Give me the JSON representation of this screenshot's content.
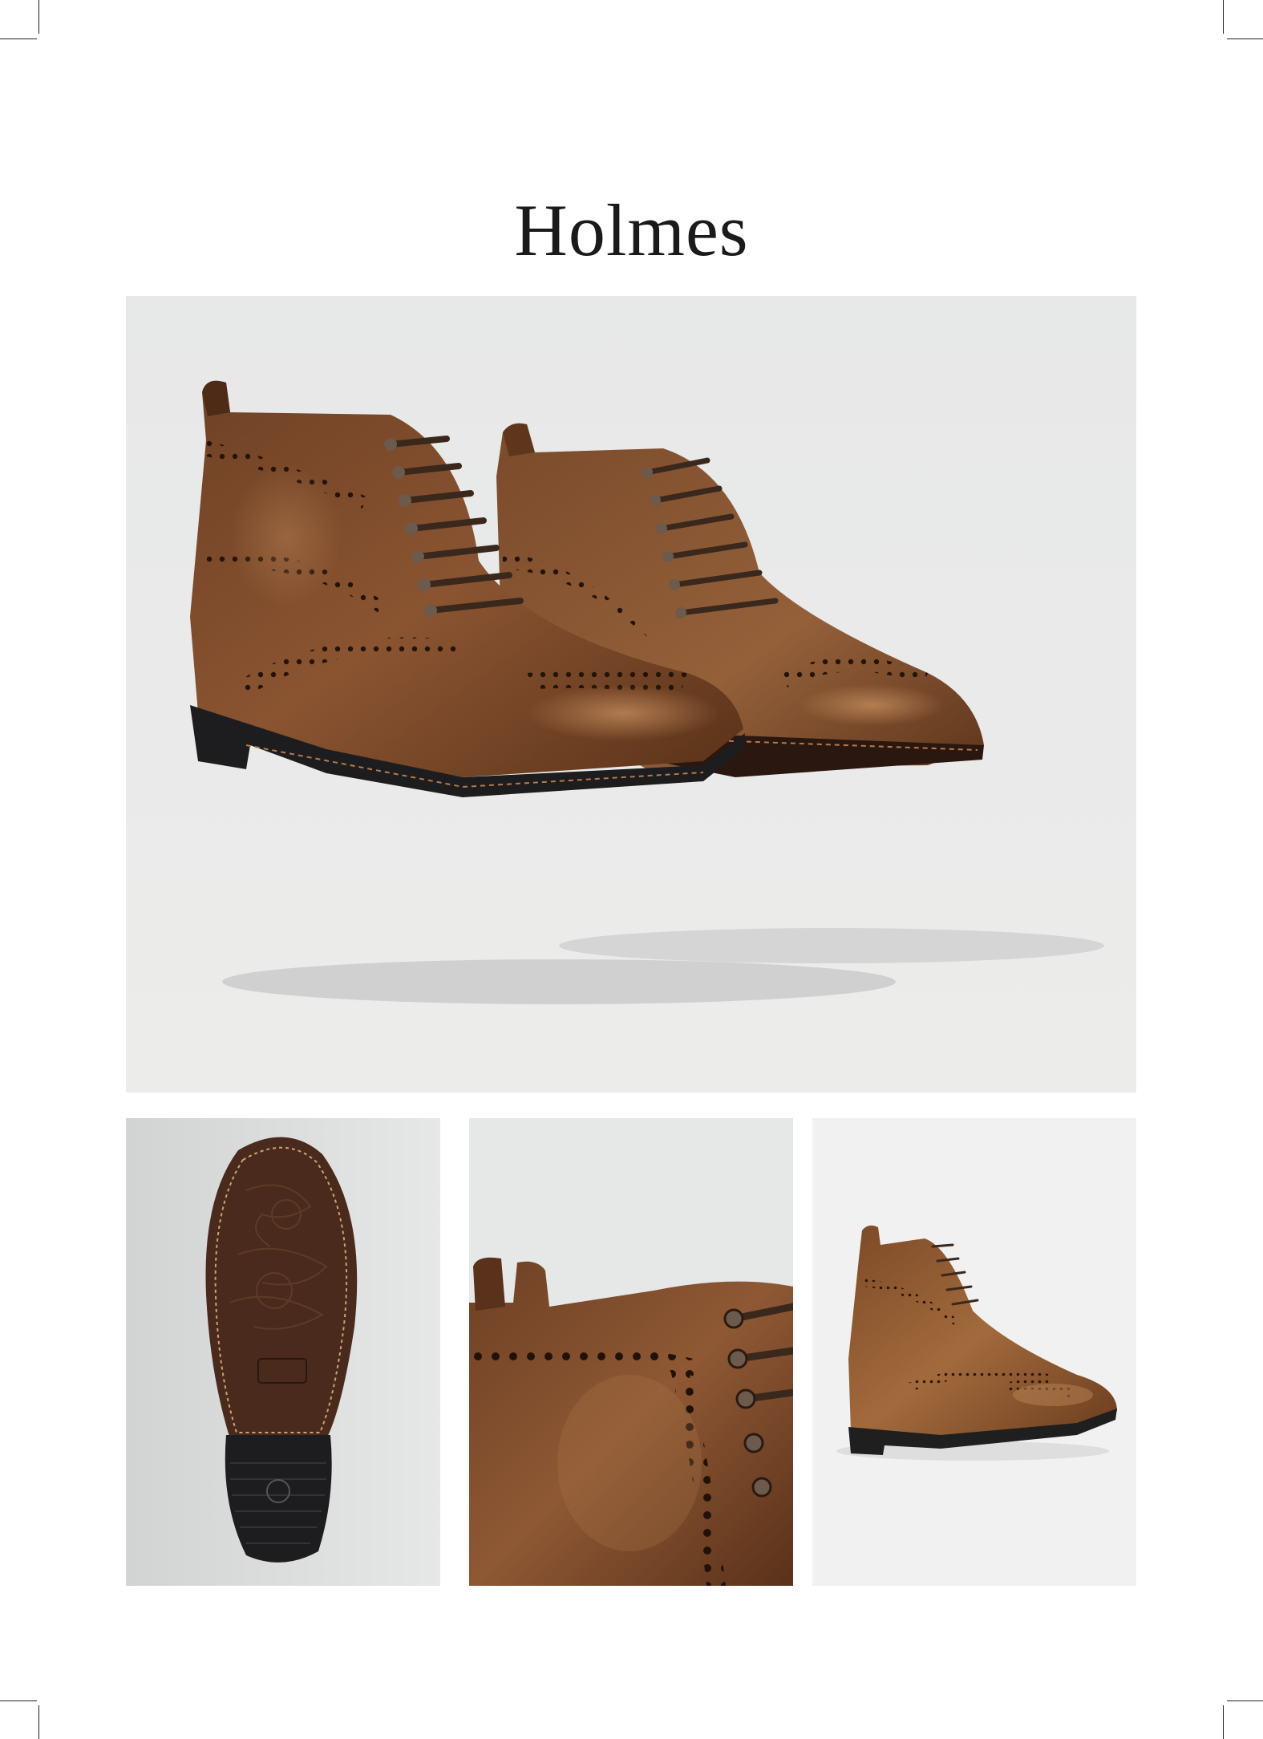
{
  "page": {
    "title": "Holmes"
  },
  "images": {
    "hero": "pair-of-brown-leather-brogue-boots",
    "sole": "boot-sole-underside",
    "detail": "boot-collar-closeup",
    "back": "single-boot-rear-three-quarter"
  },
  "colors": {
    "leather": "#7a4a2a",
    "leather_light": "#9c6438",
    "leather_dark": "#4e2b17",
    "sole_rubber": "#1d1d1f",
    "lace": "#3a281c",
    "background_light": "#e9eaea"
  }
}
